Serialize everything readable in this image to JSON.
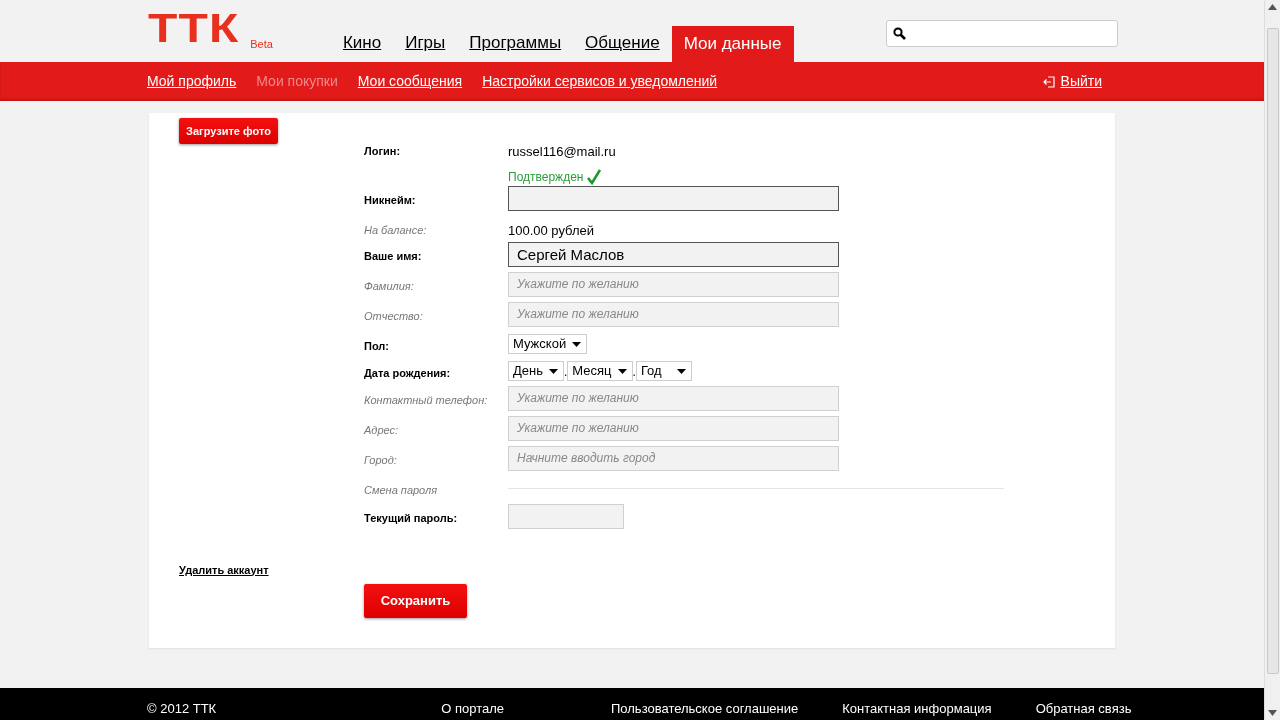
{
  "logo": {
    "text": "ТТК",
    "badge": "Beta"
  },
  "nav": [
    {
      "label": "Кино",
      "selected": false
    },
    {
      "label": "Игры",
      "selected": false
    },
    {
      "label": "Программы",
      "selected": false
    },
    {
      "label": "Общение",
      "selected": false
    },
    {
      "label": "Мои данные",
      "selected": true
    }
  ],
  "subnav": [
    {
      "label": "Мой профиль",
      "disabled": false
    },
    {
      "label": "Мои покупки",
      "disabled": true
    },
    {
      "label": "Мои сообщения",
      "disabled": false
    },
    {
      "label": "Настройки сервисов и уведомлений",
      "disabled": false
    }
  ],
  "logout": "Выйти",
  "upload_button": "Загрузите фото",
  "delete_link": "Удалить аккаунт",
  "form": [
    {
      "kind": "static",
      "label": "Логин:",
      "optional": false,
      "value": "russel116@mail.ru",
      "note": "Подтвержден"
    },
    {
      "kind": "text",
      "label": "Никнейм:",
      "optional": false
    },
    {
      "kind": "static",
      "label": "На балансе:",
      "optional": true,
      "value": "100.00 рублей"
    },
    {
      "kind": "text",
      "label": "Ваше имя:",
      "optional": false,
      "value": "Сергей Маслов"
    },
    {
      "kind": "text",
      "label": "Фамилия:",
      "optional": true,
      "placeholder": "Укажите по желанию"
    },
    {
      "kind": "text",
      "label": "Отчество:",
      "optional": true,
      "placeholder": "Укажите по желанию"
    },
    {
      "kind": "select",
      "label": "Пол:",
      "optional": false,
      "options": [
        "Мужской"
      ]
    },
    {
      "kind": "select",
      "label": "Дата рождения:",
      "optional": false,
      "options": [
        "День",
        "Месяц",
        "Год"
      ],
      "separator": "."
    },
    {
      "kind": "text",
      "label": "Контактный телефон:",
      "optional": true,
      "placeholder": "Укажите по желанию"
    },
    {
      "kind": "text",
      "label": "Адрес:",
      "optional": true,
      "placeholder": "Укажите по желанию"
    },
    {
      "kind": "text",
      "label": "Город:",
      "optional": true,
      "placeholder": "Начните вводить город"
    },
    {
      "kind": "divider",
      "label": "Смена пароля",
      "optional": true
    },
    {
      "kind": "password",
      "label": "Текущий пароль:",
      "optional": false
    }
  ],
  "save_button": "Сохранить",
  "footer": {
    "copyright": "© 2012 ТТК",
    "links": [
      "О портале",
      "Пользовательское соглашение",
      "Контактная информация",
      "Обратная связь"
    ]
  }
}
